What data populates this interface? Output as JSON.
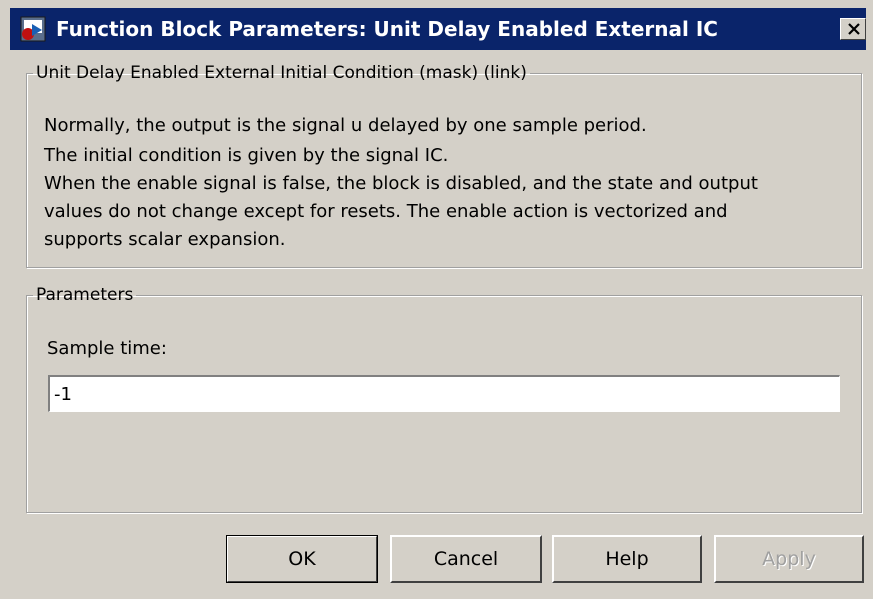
{
  "window": {
    "title": "Function Block Parameters: Unit Delay Enabled External IC",
    "icon": "simulink-block-icon",
    "close_label": "close"
  },
  "description_group": {
    "title": "Unit Delay Enabled External Initial Condition (mask) (link)",
    "lines": [
      "Normally, the output is the signal u delayed by one sample period.",
      "The initial condition is given by the signal IC.",
      "When the enable signal is false, the block is disabled, and the state and output",
      "values do not change except for resets.  The enable action is vectorized and",
      "supports scalar expansion."
    ]
  },
  "parameters_group": {
    "title": "Parameters",
    "sample_time_label": "Sample time:",
    "sample_time_value": "-1"
  },
  "buttons": {
    "ok": "OK",
    "cancel": "Cancel",
    "help": "Help",
    "apply": "Apply"
  }
}
